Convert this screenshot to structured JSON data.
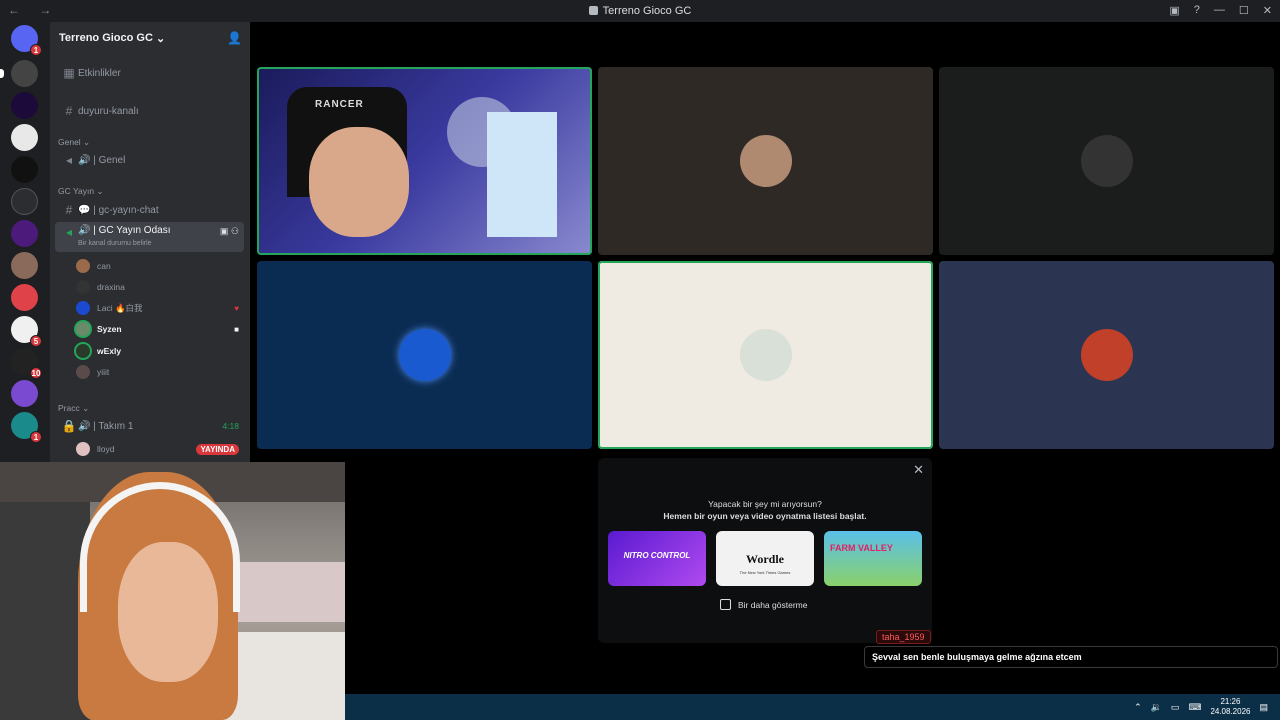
{
  "window": {
    "title": "Terreno Gioco GC",
    "nav_label": "← →"
  },
  "servers": [
    {
      "badge": "1"
    },
    {
      "badge": ""
    },
    {
      "badge": ""
    },
    {
      "badge": ""
    },
    {
      "badge": ""
    },
    {
      "badge": ""
    },
    {
      "badge": ""
    },
    {
      "badge": ""
    },
    {
      "badge": ""
    },
    {
      "badge": "5"
    },
    {
      "badge": "10"
    },
    {
      "badge": ""
    },
    {
      "badge": "1"
    }
  ],
  "guild": {
    "name": "Terreno Gioco GC",
    "events_label": "Etkinlikler",
    "announcements_channel": "duyuru-kanalı",
    "categories": {
      "genel": "Genel",
      "gc_yayin": "GC Yayın",
      "pracc": "Pracc"
    },
    "voice_genel": "🔊 | Genel",
    "text_gc_chat": "💬 | gc-yayın-chat",
    "active_voice": "🔊 | GC Yayın Odası",
    "active_status": "Bir kanal durumu belirle",
    "voice_users": [
      {
        "name": "can",
        "bold": false
      },
      {
        "name": "draxina",
        "bold": false
      },
      {
        "name": "Laci 🔥白我",
        "bold": false
      },
      {
        "name": "Syzen",
        "bold": true
      },
      {
        "name": "wExly",
        "bold": true
      },
      {
        "name": "yiiit",
        "bold": false
      }
    ],
    "team_channel": "🔊 | Takım 1",
    "team_time": "4:18",
    "team_user": "lloyd",
    "live_badge": "YAYINDA"
  },
  "stage": {
    "tile_label_streamer": "RANCER"
  },
  "activity_popup": {
    "question": "Yapacak bir şey mi arıyorsun?",
    "subtitle": "Hemen bir oyun veya video oynatma listesi başlat.",
    "activities": [
      "NITRO CONTROL",
      "Wordle",
      "FARM VALLEY"
    ],
    "wordle_sub": "The New York Times Games",
    "checkbox_label": "Bir daha gösterme",
    "close_label": "✕"
  },
  "chat_overlay": {
    "username": "taha_1959",
    "message": "Şevval sen benle buluşmaya gelme ağzına etcem"
  },
  "taskbar": {
    "time": "21:26",
    "date": "24.08.2026"
  },
  "colors": {
    "accent_green": "#23a55a",
    "live_red": "#da373c",
    "taskbar_blue": "#0b2f47"
  }
}
